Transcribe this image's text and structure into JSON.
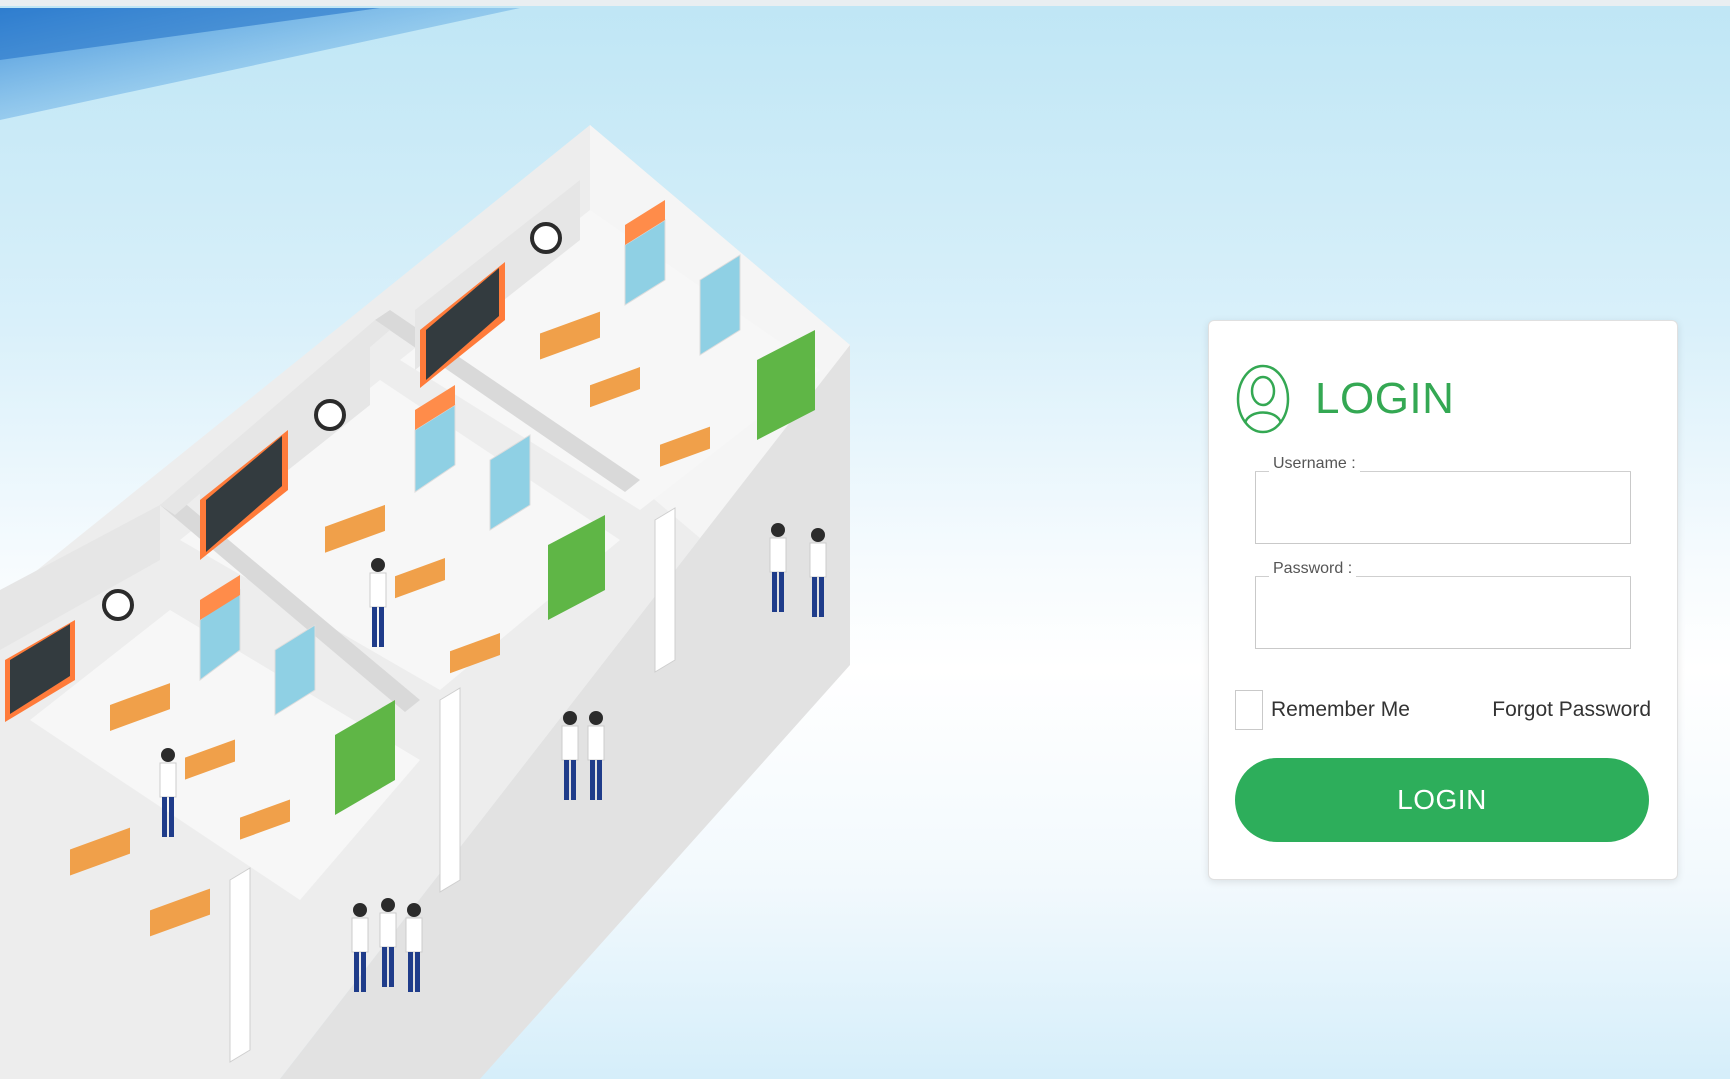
{
  "login_card": {
    "title": "LOGIN",
    "username": {
      "label": "Username :",
      "value": "",
      "placeholder": ""
    },
    "password": {
      "label": "Password :",
      "value": "",
      "placeholder": ""
    },
    "remember_label": "Remember Me",
    "remember_checked": false,
    "forgot_label": "Forgot Password",
    "submit_label": "LOGIN"
  },
  "icons": {
    "user": "user-outline-icon",
    "check": "checkbox-empty"
  },
  "colors": {
    "accent": "#2dae5b",
    "title": "#34a853",
    "background_top": "#bfe6f5",
    "background_bottom": "#d5eefa"
  }
}
